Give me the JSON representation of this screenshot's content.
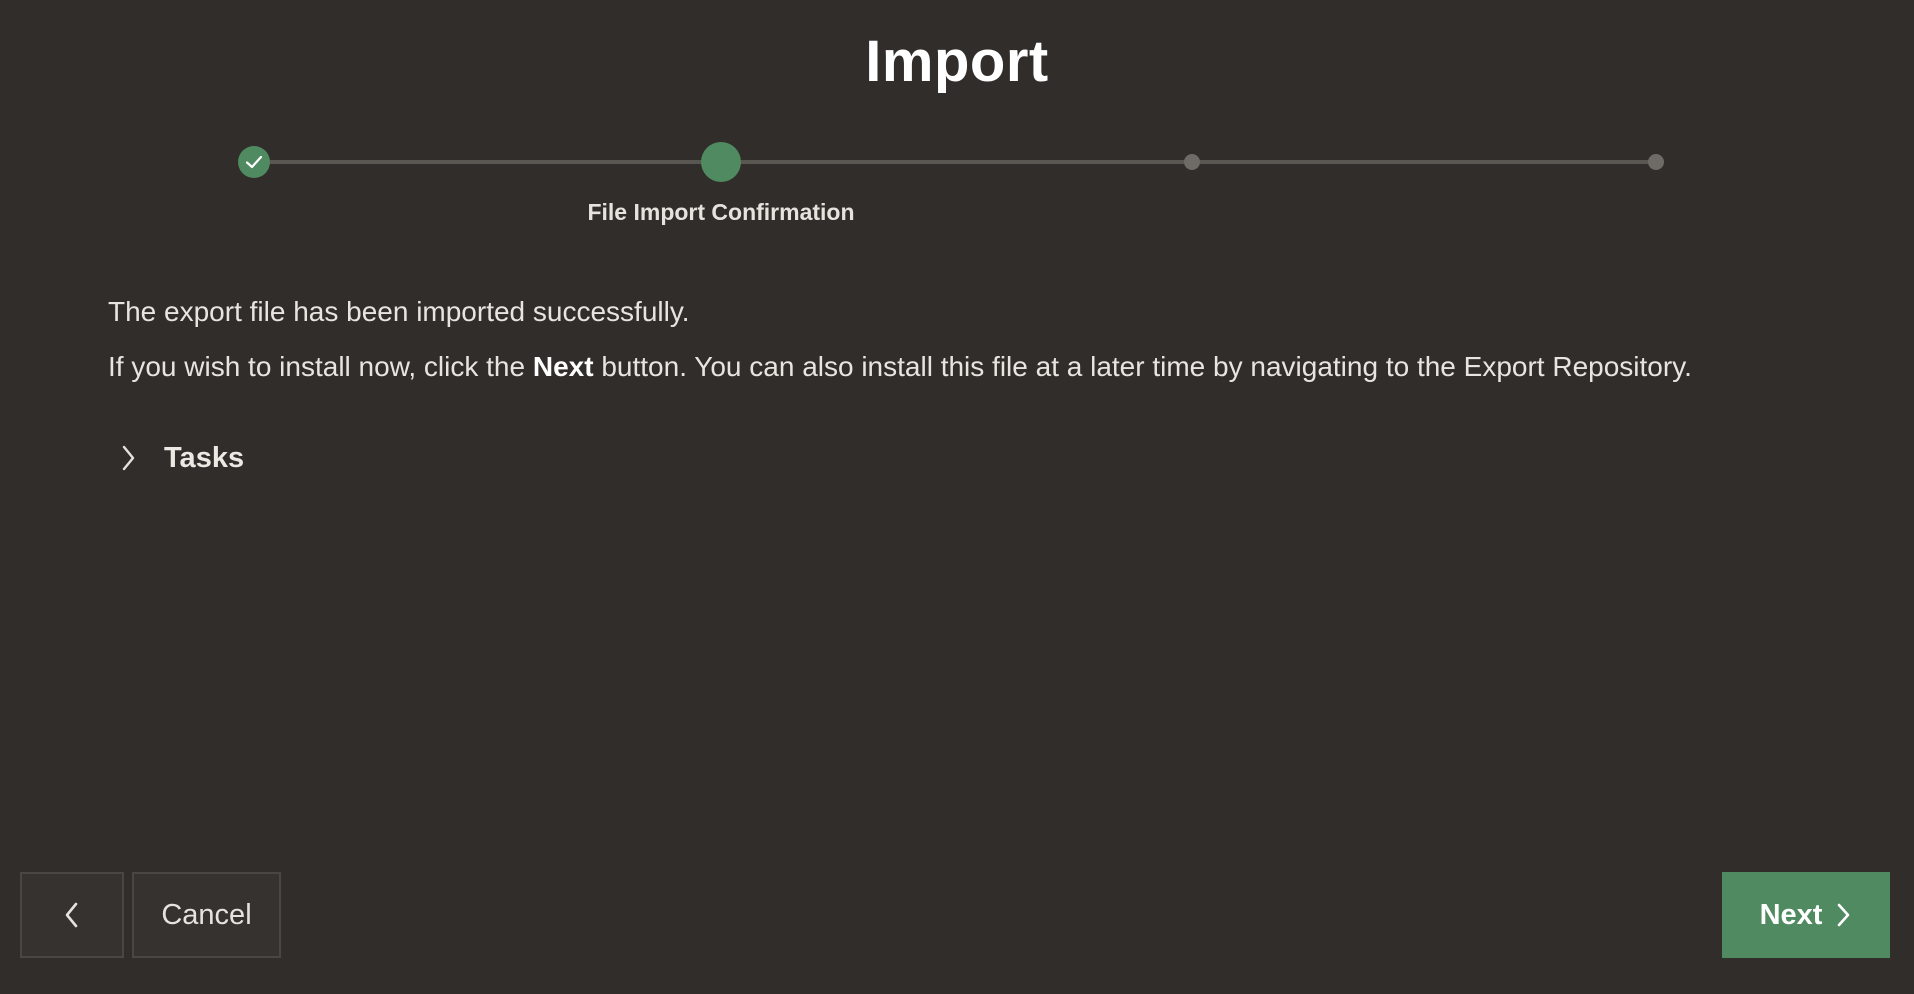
{
  "page": {
    "title": "Import"
  },
  "wizard": {
    "steps_total": 4,
    "current_step": 2,
    "current_step_label": "File Import Confirmation"
  },
  "content": {
    "success_message": "The export file has been imported successfully.",
    "install_prefix": "If you wish to install now, click the ",
    "install_bold": "Next",
    "install_suffix": " button. You can also install this file at a later time by navigating to the Export Repository.",
    "tasks_label": "Tasks"
  },
  "footer": {
    "cancel_label": "Cancel",
    "next_label": "Next"
  },
  "colors": {
    "background": "#312d2a",
    "accent": "#4f8a60"
  },
  "icons": {
    "back": "chevron-left-icon",
    "tasks_toggle": "chevron-right-icon",
    "next": "chevron-right-icon",
    "done_step": "check-icon"
  }
}
